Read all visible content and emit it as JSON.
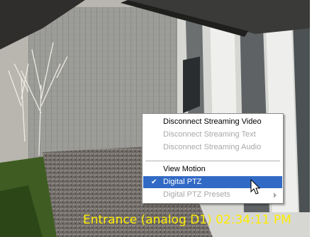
{
  "overlay": {
    "caption": "Entrance (analog D1) 02:34:11 PM"
  },
  "context_menu": {
    "items": [
      {
        "label": "Disconnect Streaming Video",
        "enabled": true
      },
      {
        "label": "Disconnect Streaming Text",
        "enabled": false
      },
      {
        "label": "Disconnect Streaming Audio",
        "enabled": false
      },
      {
        "label": "View Motion",
        "enabled": true
      },
      {
        "label": "Digital PTZ",
        "enabled": true,
        "checked": true,
        "highlighted": true
      },
      {
        "label": "Digital PTZ Presets",
        "enabled": false,
        "has_submenu": true
      }
    ]
  },
  "icons": {
    "check": "checkmark-icon",
    "submenu": "submenu-arrow-icon",
    "cursor": "mouse-pointer-icon"
  },
  "colors": {
    "overlay_text": "#ffee00",
    "highlight": "#316ac5",
    "disabled_text": "#a7a7a7"
  }
}
